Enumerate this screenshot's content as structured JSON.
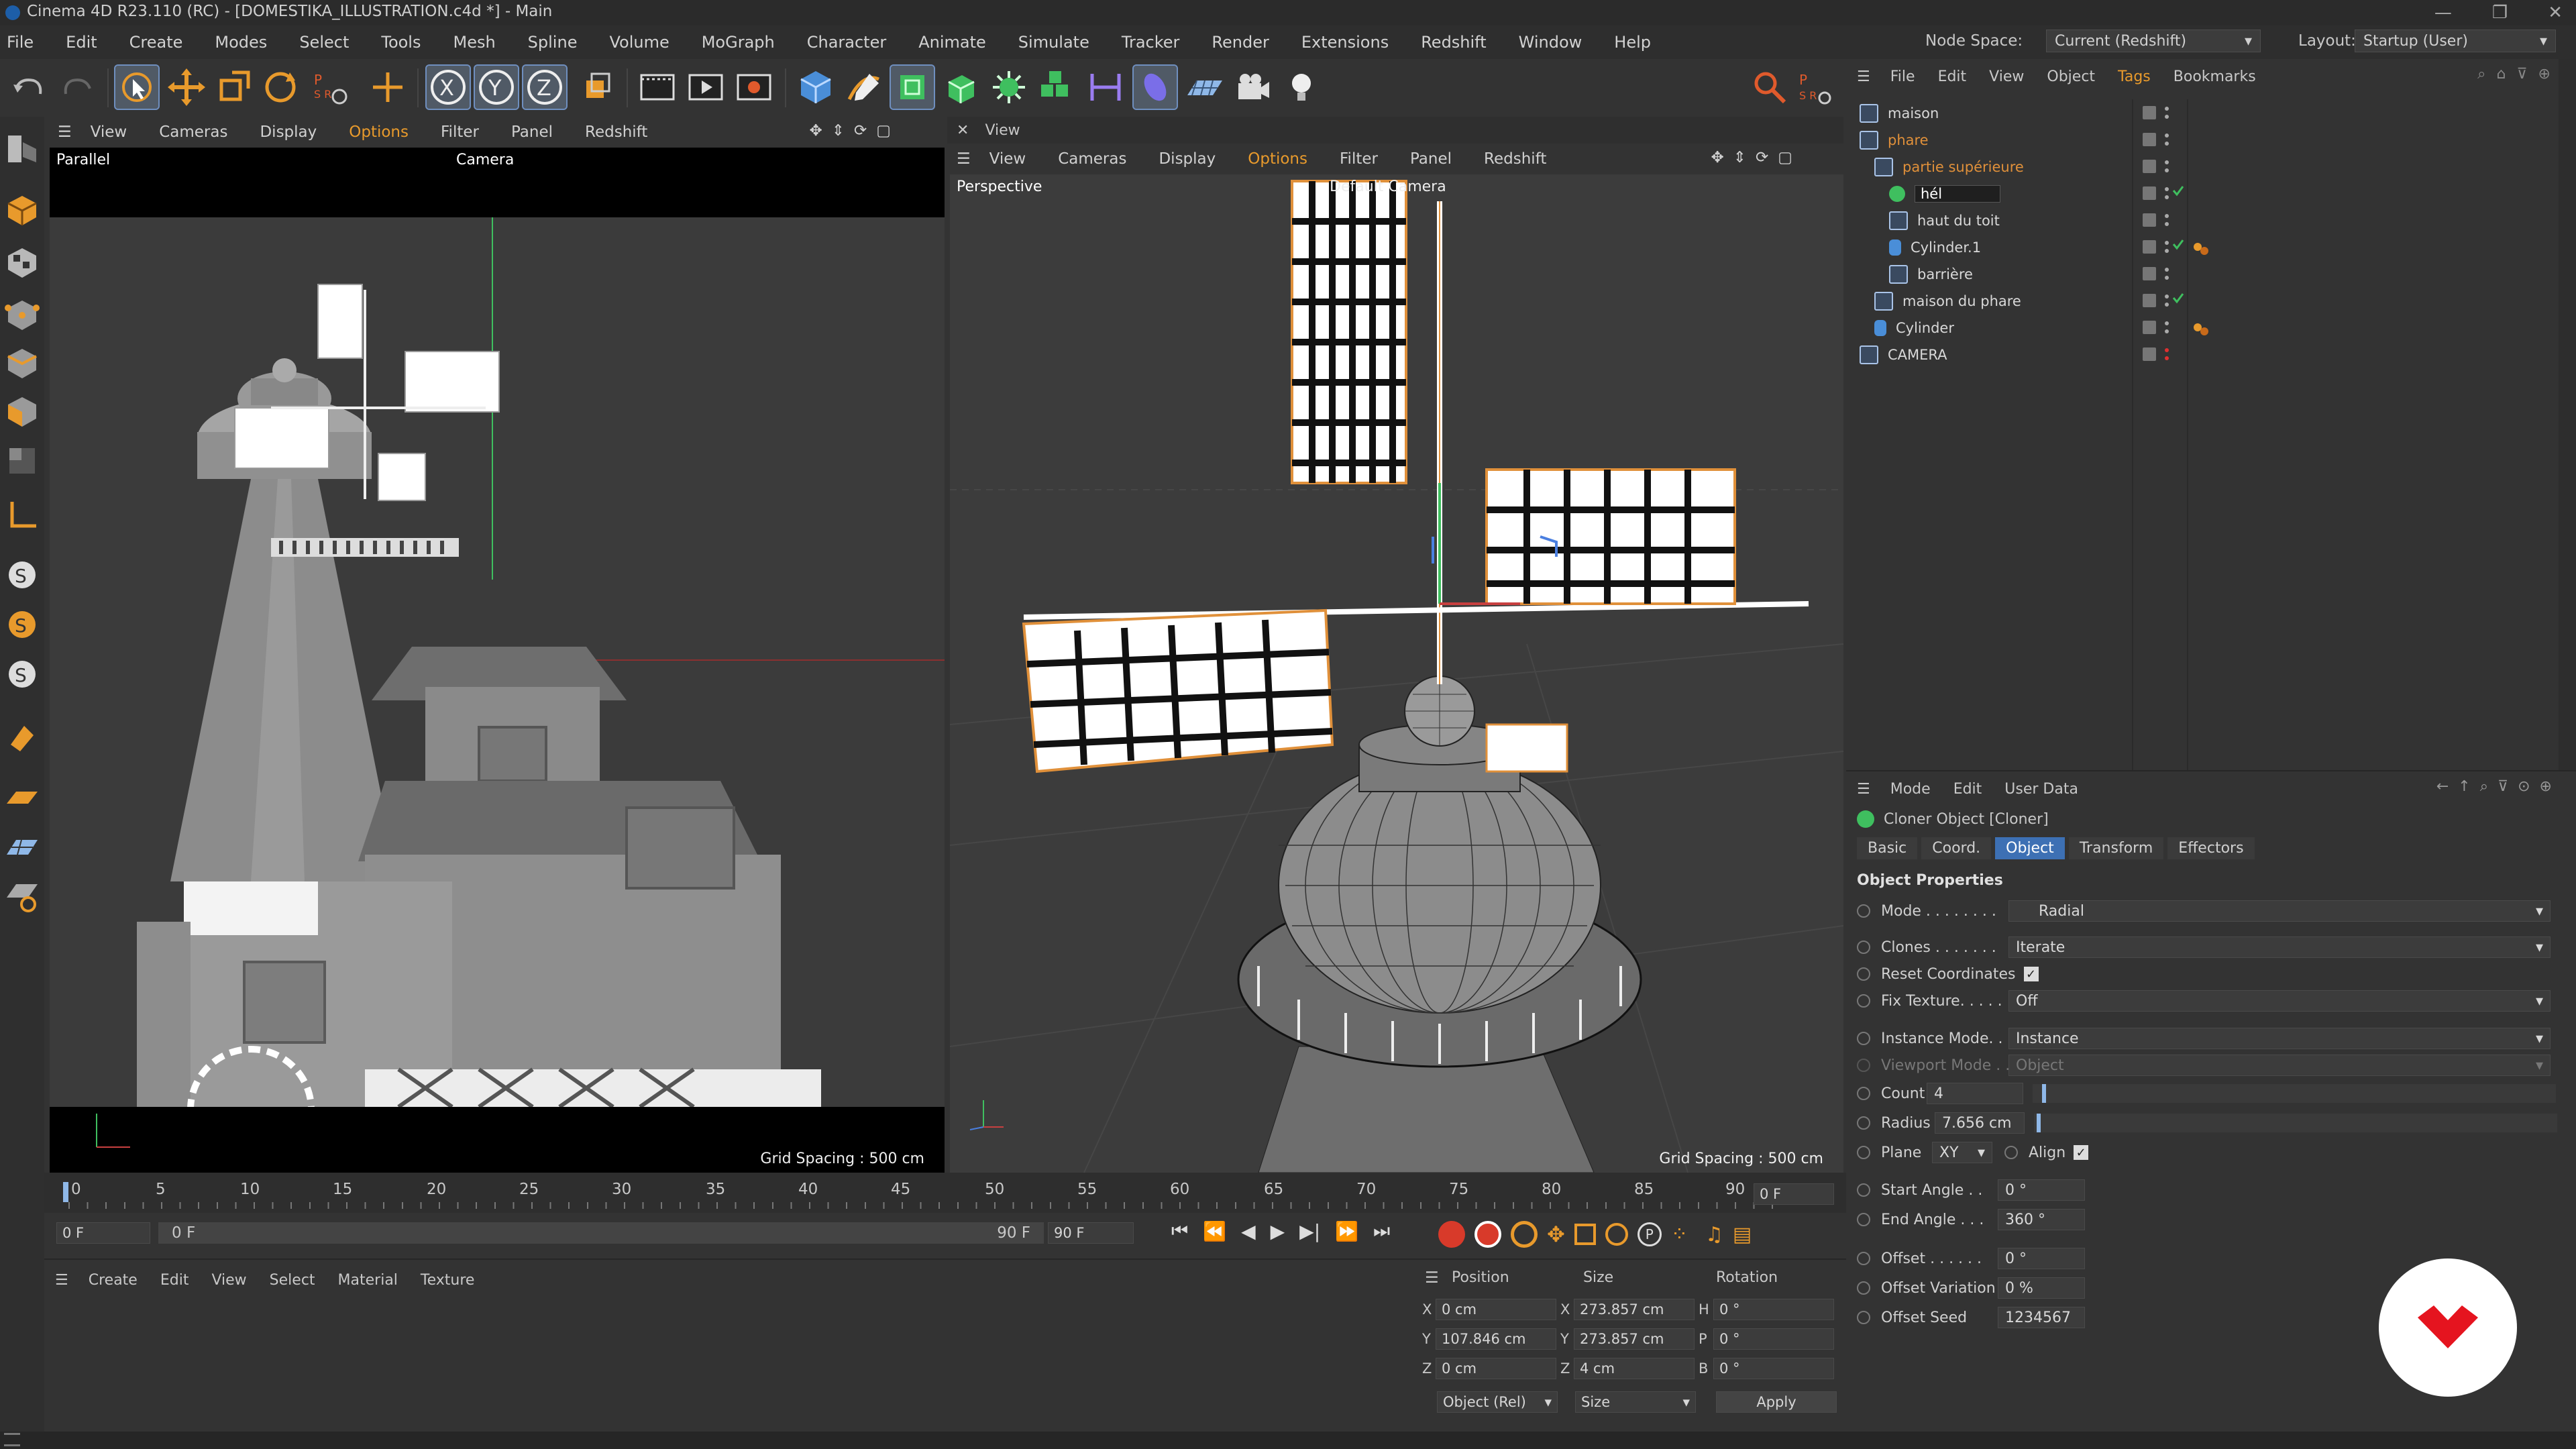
{
  "window": {
    "title": "Cinema 4D R23.110 (RC) - [DOMESTIKA_ILLUSTRATION.c4d *] - Main",
    "controls": [
      "—",
      "❐",
      "✕"
    ]
  },
  "menubar": {
    "items": [
      "File",
      "Edit",
      "Create",
      "Modes",
      "Select",
      "Tools",
      "Mesh",
      "Spline",
      "Volume",
      "MoGraph",
      "Character",
      "Animate",
      "Simulate",
      "Tracker",
      "Render",
      "Extensions",
      "Redshift",
      "Window",
      "Help"
    ],
    "node_space_label": "Node Space:",
    "node_space_value": "Current (Redshift)",
    "layout_label": "Layout:",
    "layout_value": "Startup (User)"
  },
  "viewport_left": {
    "menu": [
      "View",
      "Cameras",
      "Display",
      "Options",
      "Filter",
      "Panel",
      "Redshift"
    ],
    "projection": "Parallel",
    "camera": "Camera",
    "grid": "Grid Spacing : 500 cm"
  },
  "viewport_right": {
    "tab": "View",
    "menu": [
      "View",
      "Cameras",
      "Display",
      "Options",
      "Filter",
      "Panel",
      "Redshift"
    ],
    "projection": "Perspective",
    "camera": "Default Camera",
    "grid": "Grid Spacing : 500 cm"
  },
  "object_manager": {
    "menu": [
      "File",
      "Edit",
      "View",
      "Object",
      "Tags",
      "Bookmarks"
    ],
    "rows": [
      {
        "name": "maison",
        "indent": 0,
        "color": "#d8d8d8"
      },
      {
        "name": "phare",
        "indent": 0,
        "color": "#e0903a"
      },
      {
        "name": "partie supérieure",
        "indent": 1,
        "color": "#e0903a"
      },
      {
        "name": "hél",
        "indent": 2,
        "color": "#ffffff"
      },
      {
        "name": "haut du toit",
        "indent": 2,
        "color": "#d8d8d8"
      },
      {
        "name": "Cylinder.1",
        "indent": 2,
        "color": "#d8d8d8"
      },
      {
        "name": "barrière",
        "indent": 2,
        "color": "#d8d8d8"
      },
      {
        "name": "maison du phare",
        "indent": 1,
        "color": "#d8d8d8"
      },
      {
        "name": "Cylinder",
        "indent": 1,
        "color": "#d8d8d8"
      },
      {
        "name": "CAMERA",
        "indent": 0,
        "color": "#d8d8d8"
      }
    ]
  },
  "attribute_manager": {
    "menu": [
      "Mode",
      "Edit",
      "User Data"
    ],
    "object_title": "Cloner Object [Cloner]",
    "tabs": [
      "Basic",
      "Coord.",
      "Object",
      "Transform",
      "Effectors"
    ],
    "active_tab": "Object",
    "section": "Object Properties",
    "props": {
      "mode_label": "Mode . . . . . . . .",
      "mode_value": "Radial",
      "clones_label": "Clones . . . . . . .",
      "clones_value": "Iterate",
      "reset_label": "Reset Coordinates",
      "fixtex_label": "Fix Texture. . . . .",
      "fixtex_value": "Off",
      "instance_label": "Instance Mode. .",
      "instance_value": "Instance",
      "viewport_label": "Viewport Mode . .",
      "viewport_value": "Object",
      "count_label": "Count",
      "count_value": "4",
      "radius_label": "Radius",
      "radius_value": "7.656 cm",
      "plane_label": "Plane",
      "plane_value": "XY",
      "align_label": "Align",
      "start_label": "Start Angle . .",
      "start_value": "0 °",
      "end_label": "End Angle . . .",
      "end_value": "360 °",
      "offset_label": "Offset . . . . . .",
      "offset_value": "0 °",
      "offvar_label": "Offset Variation",
      "offvar_value": "0 %",
      "offseed_label": "Offset Seed",
      "offseed_value": "1234567"
    }
  },
  "timeline": {
    "ticks": [
      "0",
      "5",
      "10",
      "15",
      "20",
      "25",
      "30",
      "35",
      "40",
      "45",
      "50",
      "55",
      "60",
      "65",
      "70",
      "75",
      "80",
      "85",
      "90"
    ],
    "current_frame": "0 F",
    "start": "0 F",
    "range_start": "0 F",
    "range_end": "90 F",
    "end": "90 F"
  },
  "material_manager": {
    "menu": [
      "Create",
      "Edit",
      "View",
      "Select",
      "Material",
      "Texture"
    ]
  },
  "coordinates": {
    "headers": [
      "Position",
      "Size",
      "Rotation"
    ],
    "pos": {
      "x": "0 cm",
      "y": "107.846 cm",
      "z": "0 cm"
    },
    "size": {
      "x": "273.857 cm",
      "y": "273.857 cm",
      "z": "4 cm"
    },
    "rot": {
      "h": "0 °",
      "p": "0 °",
      "b": "0 °"
    },
    "axis_labels": [
      "X",
      "Y",
      "Z",
      "H",
      "P",
      "B"
    ],
    "mode_select": "Object (Rel)",
    "size_select": "Size",
    "apply": "Apply"
  },
  "colors": {
    "accent": "#3d70b4",
    "selection_orange": "#e0903a",
    "logo_red": "#e5141f"
  }
}
